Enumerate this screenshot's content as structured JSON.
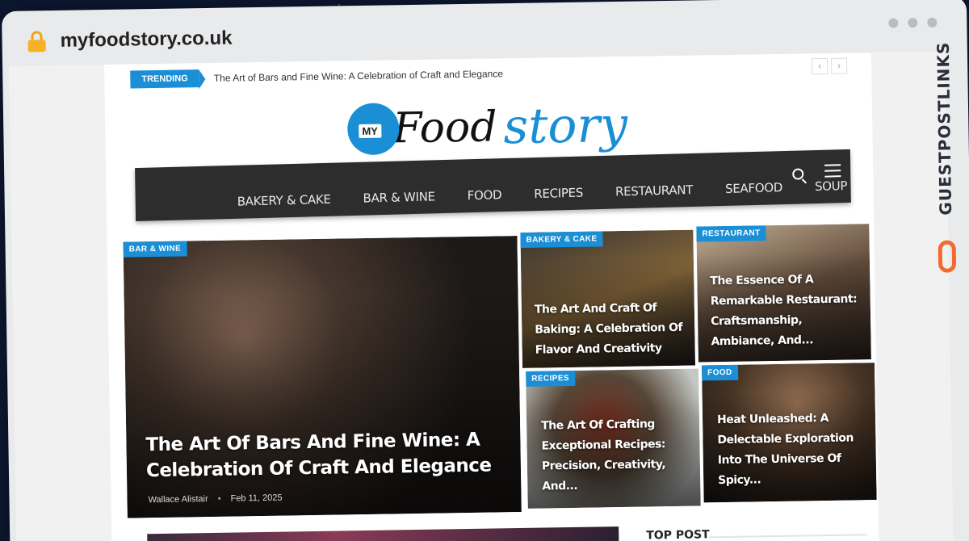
{
  "browser": {
    "url": "myfoodstory.co.uk"
  },
  "trending": {
    "badge": "TRENDING",
    "headline": "The Art of Bars and Fine Wine: A Celebration of Craft and Elegance",
    "prev": "‹",
    "next": "›"
  },
  "logo": {
    "badge": "MY",
    "word1": "Food",
    "word2": "story"
  },
  "nav": {
    "items": [
      "BAKERY & CAKE",
      "BAR & WINE",
      "FOOD",
      "RECIPES",
      "RESTAURANT",
      "SEAFOOD",
      "SOUP"
    ],
    "search_icon": "search-icon",
    "menu_icon": "hamburger-icon"
  },
  "featured": {
    "main": {
      "category": "BAR & WINE",
      "title": "The Art Of Bars And Fine Wine: A Celebration Of Craft And Elegance",
      "author": "Wallace Alistair",
      "date": "Feb 11, 2025"
    },
    "tiles": [
      {
        "category": "BAKERY & CAKE",
        "title": "The Art And Craft Of Baking: A Celebration Of Flavor And Creativity"
      },
      {
        "category": "RESTAURANT",
        "title": "The Essence Of A Remarkable Restaurant: Craftsmanship, Ambiance, And..."
      },
      {
        "category": "RECIPES",
        "title": "The Art Of Crafting Exceptional Recipes: Precision, Creativity, And..."
      },
      {
        "category": "FOOD",
        "title": "Heat Unleashed: A Delectable Exploration Into The Universe Of Spicy..."
      }
    ]
  },
  "sidebar": {
    "top_post": "TOP POST"
  },
  "side_brand": {
    "text": "GUESTPOSTLINKS"
  },
  "colors": {
    "accent": "#1a8fd6",
    "nav_bg": "#2d2d2d",
    "brand_orange": "#f26a2d"
  }
}
